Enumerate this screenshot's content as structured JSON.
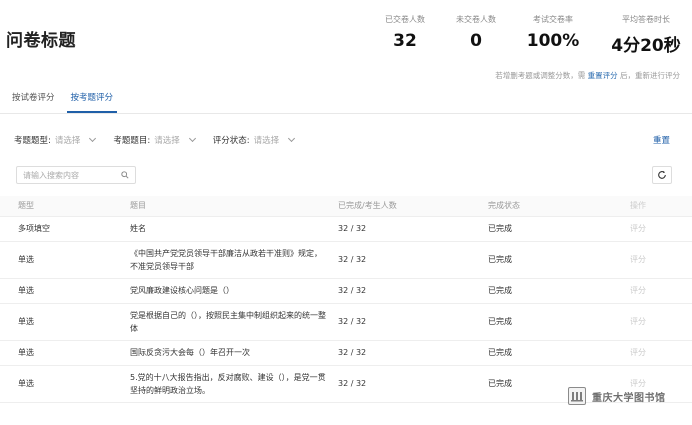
{
  "page": {
    "title": "问卷标题"
  },
  "stats": [
    {
      "label": "已交卷人数",
      "value": "32"
    },
    {
      "label": "未交卷人数",
      "value": "0"
    },
    {
      "label": "考试交卷率",
      "value": "100%"
    },
    {
      "label": "平均答卷时长",
      "value": "4分20秒"
    }
  ],
  "hint": {
    "prefix": "若增删考题或调整分数，需",
    "link": "重置评分",
    "suffix": "后，重新进行评分"
  },
  "tabs": [
    {
      "label": "按试卷评分",
      "active": false
    },
    {
      "label": "按考题评分",
      "active": true
    }
  ],
  "filters": [
    {
      "label": "考题题型:",
      "placeholder": "请选择"
    },
    {
      "label": "考题题目:",
      "placeholder": "请选择"
    },
    {
      "label": "评分状态:",
      "placeholder": "请选择"
    }
  ],
  "reset_label": "重置",
  "search": {
    "placeholder": "请输入搜索内容"
  },
  "table": {
    "headers": [
      "题型",
      "题目",
      "已完成/考生人数",
      "完成状态",
      "操作"
    ],
    "rows": [
      {
        "type": "多项填空",
        "question": "姓名",
        "progress": "32 / 32",
        "status": "已完成",
        "action": "评分"
      },
      {
        "type": "单选",
        "question": "《中国共产党党员领导干部廉洁从政若干准则》规定，不准党员领导干部",
        "progress": "32 / 32",
        "status": "已完成",
        "action": "评分"
      },
      {
        "type": "单选",
        "question": "党风廉政建设核心问题是（）",
        "progress": "32 / 32",
        "status": "已完成",
        "action": "评分"
      },
      {
        "type": "单选",
        "question": "党是根据自己的（），按照民主集中制组织起来的统一整体",
        "progress": "32 / 32",
        "status": "已完成",
        "action": "评分"
      },
      {
        "type": "单选",
        "question": "国际反贪污大会每（）年召开一次",
        "progress": "32 / 32",
        "status": "已完成",
        "action": "评分"
      },
      {
        "type": "单选",
        "question": "5.党的十八大报告指出，反对腐败、建设（），是党一贯坚持的鲜明政治立场。",
        "progress": "32 / 32",
        "status": "已完成",
        "action": "评分"
      }
    ]
  },
  "watermark": {
    "text": "重庆大学图书馆"
  }
}
